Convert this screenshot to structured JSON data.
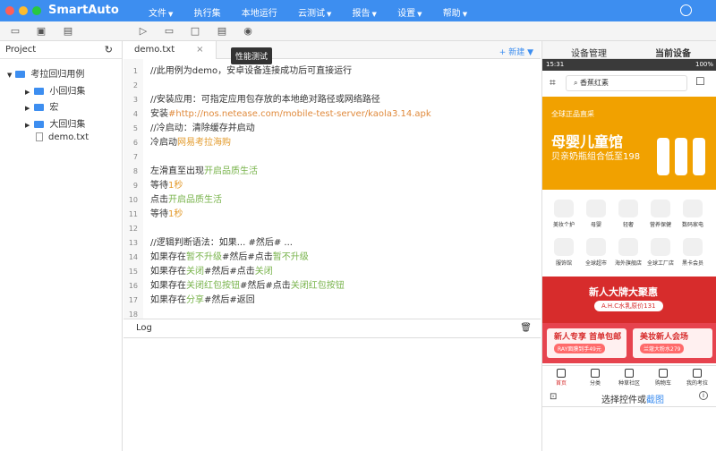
{
  "app": {
    "title": "SmartAuto"
  },
  "menu": [
    {
      "label": "文件"
    },
    {
      "label": "执行集"
    },
    {
      "label": "本地运行"
    },
    {
      "label": "云测试"
    },
    {
      "label": "报告"
    },
    {
      "label": "设置"
    },
    {
      "label": "帮助"
    }
  ],
  "toolbar": {
    "tooltip": "性能测试"
  },
  "project": {
    "title": "Project",
    "root": "考拉回归用例",
    "items": [
      {
        "label": "小回归集",
        "type": "folder"
      },
      {
        "label": "宏",
        "type": "folder"
      },
      {
        "label": "大回归集",
        "type": "folder"
      },
      {
        "label": "demo.txt",
        "type": "file"
      }
    ]
  },
  "editor": {
    "tab": "demo.txt",
    "new_label": "+ 新建",
    "lines": [
      [
        {
          "t": "//此用例为demo，安卓设备连接成功后可直接运行",
          "c": "n"
        }
      ],
      [],
      [
        {
          "t": "//安装应用：可指定应用包存放的本地绝对路径或网络路径",
          "c": "n"
        }
      ],
      [
        {
          "t": "安装",
          "c": "n"
        },
        {
          "t": "#http://nos.netease.com/mobile-test-server/kaola3.14.apk",
          "c": "l"
        }
      ],
      [
        {
          "t": "//冷启动：清除缓存并启动",
          "c": "n"
        }
      ],
      [
        {
          "t": "冷启动",
          "c": "n"
        },
        {
          "t": "网易考拉海购",
          "c": "o"
        }
      ],
      [],
      [
        {
          "t": "左滑直至出现",
          "c": "n"
        },
        {
          "t": "开启品质生活",
          "c": "g"
        }
      ],
      [
        {
          "t": "等待",
          "c": "n"
        },
        {
          "t": "1秒",
          "c": "o"
        }
      ],
      [
        {
          "t": "点击",
          "c": "n"
        },
        {
          "t": "开启品质生活",
          "c": "g"
        }
      ],
      [
        {
          "t": "等待",
          "c": "n"
        },
        {
          "t": "1秒",
          "c": "o"
        }
      ],
      [],
      [
        {
          "t": "//逻辑判断语法：如果... #然后# ...",
          "c": "n"
        }
      ],
      [
        {
          "t": "如果存在",
          "c": "n"
        },
        {
          "t": "暂不升级",
          "c": "g"
        },
        {
          "t": "#然后#点击",
          "c": "n"
        },
        {
          "t": "暂不升级",
          "c": "g"
        }
      ],
      [
        {
          "t": "如果存在",
          "c": "n"
        },
        {
          "t": "关闭",
          "c": "g"
        },
        {
          "t": "#然后#点击",
          "c": "n"
        },
        {
          "t": "关闭",
          "c": "g"
        }
      ],
      [
        {
          "t": "如果存在",
          "c": "n"
        },
        {
          "t": "关闭红包按钮",
          "c": "g"
        },
        {
          "t": "#然后#点击",
          "c": "n"
        },
        {
          "t": "关闭红包按钮",
          "c": "g"
        }
      ],
      [
        {
          "t": "如果存在",
          "c": "n"
        },
        {
          "t": "分享",
          "c": "g"
        },
        {
          "t": "#然后#返回",
          "c": "n"
        }
      ],
      []
    ],
    "log_title": "Log"
  },
  "right": {
    "tabs": [
      {
        "label": "设备管理"
      },
      {
        "label": "当前设备"
      }
    ],
    "phone": {
      "status_time": "15:31",
      "battery": "100%",
      "search": "香蕉红素",
      "banner": {
        "title": "母婴儿童馆",
        "subtitle": "贝亲奶瓶组合低至198",
        "tag": "全球正品直采"
      },
      "icons": [
        [
          "美妆个护",
          "母婴",
          "轻奢",
          "营养保健",
          "数码家电"
        ],
        [
          "服饰馆",
          "全球超市",
          "海外旗舰店",
          "全球工厂店",
          "黑卡会员"
        ]
      ],
      "promo": {
        "title": "新人大牌大聚惠",
        "subtitle": "A.H.C水乳原价131"
      },
      "deal_cards": [
        {
          "title": "新人专享 首单包邮",
          "subtitle": "RAY面膜到手49元"
        },
        {
          "title": "美妆新人会场",
          "subtitle": "兰蔻大粉水279"
        }
      ],
      "nav": [
        "首页",
        "分类",
        "种草社区",
        "购物车",
        "我的考拉"
      ]
    },
    "footer": {
      "text": "选择控件或",
      "link": "截图"
    }
  },
  "colors": {
    "primary": "#3d8ef0",
    "orange": "#e39b2d",
    "green": "#78b34b",
    "link": "#e08a3c"
  }
}
